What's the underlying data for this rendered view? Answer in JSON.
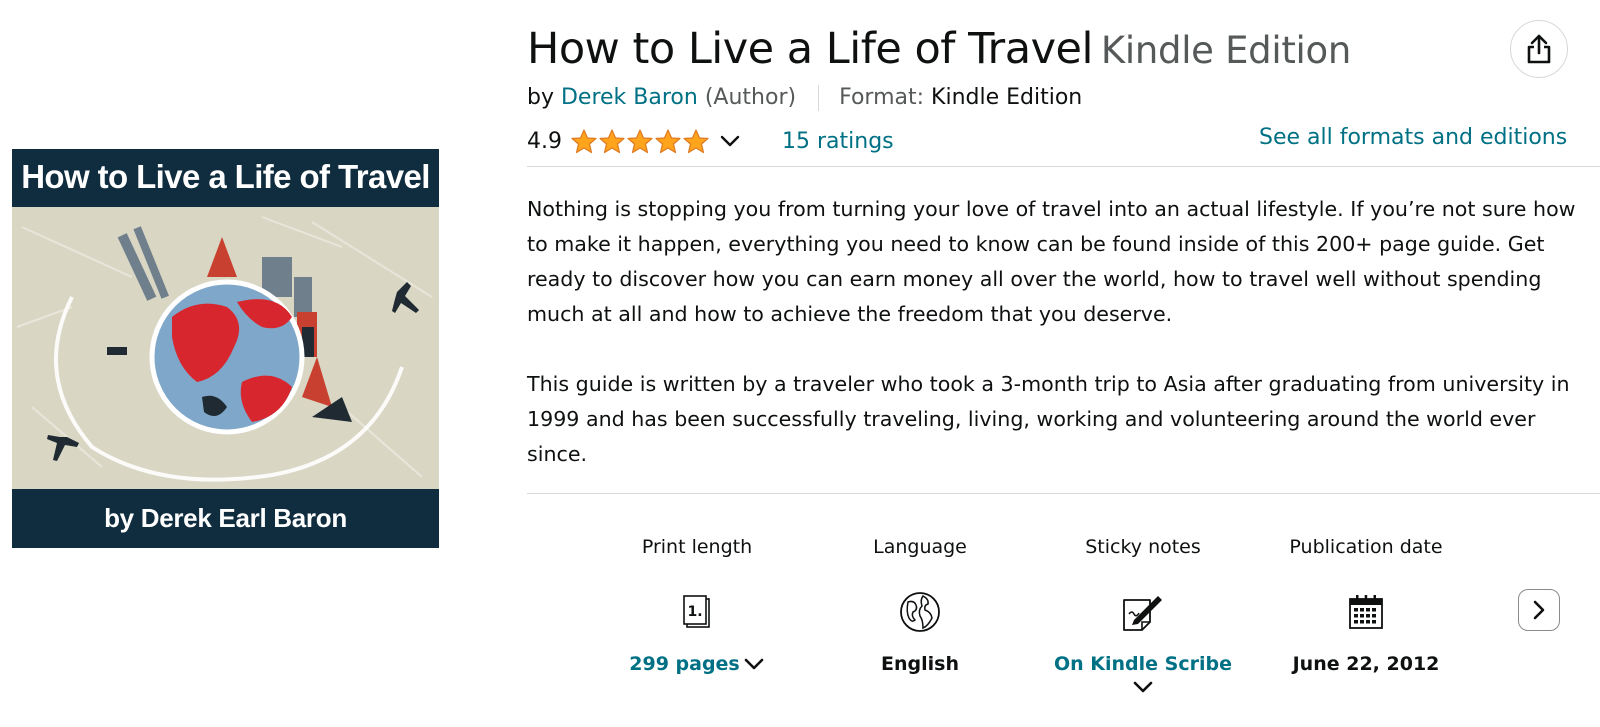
{
  "cover": {
    "title": "How to Live a Life of Travel",
    "author_line": "by Derek Earl Baron",
    "colors": {
      "band": "#0f2d3e",
      "background": "#d9d6c3",
      "ocean": "#7ea7c9",
      "land": "#d8262e"
    }
  },
  "header": {
    "title": "How to Live a Life of Travel",
    "edition": "Kindle Edition",
    "by_prefix": "by",
    "author": "Derek Baron",
    "author_role": "(Author)",
    "format_label": "Format:",
    "format_value": "Kindle Edition",
    "share_icon": "share-icon"
  },
  "rating": {
    "value": "4.9",
    "stars": 4.9,
    "max_stars": 5,
    "count_label": "15 ratings",
    "see_all": "See all formats and editions"
  },
  "description": [
    "Nothing is stopping you from turning your love of travel into an actual lifestyle. If you’re not sure how to make it happen, everything you need to know can be found inside of this 200+ page guide. Get ready to discover how you can earn money all over the world, how to travel well without spending much at all and how to achieve the freedom that you deserve.",
    "This guide is written by a traveler who took a 3-month trip to Asia after graduating from university in 1999 and has been successfully traveling, living, working and volunteering around the world ever since."
  ],
  "details": [
    {
      "label": "Print length",
      "icon": "book-pages-icon",
      "value": "299 pages"
    },
    {
      "label": "Language",
      "icon": "globe-icon",
      "value": "English"
    },
    {
      "label": "Sticky notes",
      "icon": "sticky-note-pen-icon",
      "value": "On Kindle Scribe"
    },
    {
      "label": "Publication date",
      "icon": "calendar-icon",
      "value": "June 22, 2012"
    }
  ],
  "colors": {
    "link": "#007185",
    "text": "#0f1111",
    "muted": "#565959",
    "star": "#ffa41c",
    "divider": "#d5d9d9"
  }
}
